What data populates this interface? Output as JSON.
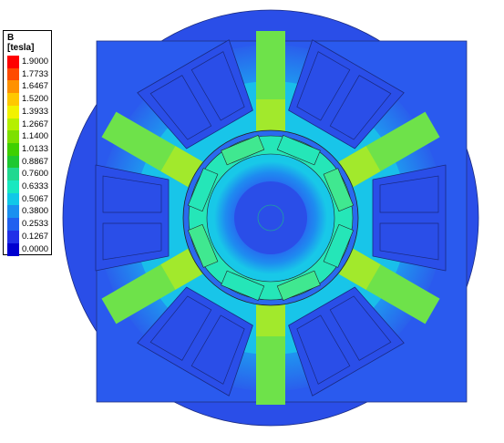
{
  "legend": {
    "title": "B",
    "unit": "[tesla]",
    "ticks": [
      "1.9000",
      "1.7733",
      "1.6467",
      "1.5200",
      "1.3933",
      "1.2667",
      "1.1400",
      "1.0133",
      "0.8867",
      "0.7600",
      "0.6333",
      "0.5067",
      "0.3800",
      "0.2533",
      "0.1267",
      "0.0000"
    ],
    "colors": [
      "#ff0000",
      "#ff4a00",
      "#ff9100",
      "#ffc800",
      "#f2f200",
      "#b5f000",
      "#7ee000",
      "#3fd000",
      "#1ec830",
      "#20d890",
      "#18e8c0",
      "#10c8e8",
      "#1a90f0",
      "#2060f0",
      "#2030e8",
      "#0000d0"
    ]
  },
  "field_colors": {
    "background": "#2a4ee8",
    "low": "#1e8cf0",
    "mid": "#18c8e8",
    "midhigh": "#25e6b8",
    "high": "#6ee24a",
    "peak": "#d8ee20",
    "slot": "#1f4ae6"
  }
}
